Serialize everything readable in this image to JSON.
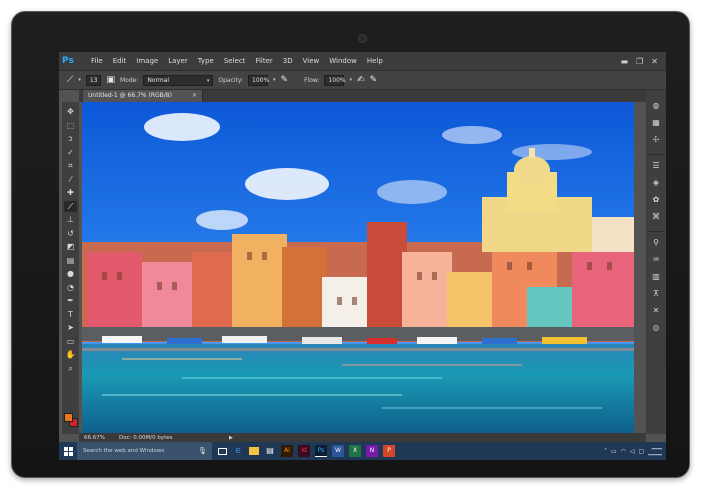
{
  "app": {
    "logo": "Ps",
    "menu": [
      "File",
      "Edit",
      "Image",
      "Layer",
      "Type",
      "Select",
      "Filter",
      "3D",
      "View",
      "Window",
      "Help"
    ],
    "window_controls": [
      "minimize-icon",
      "restore-icon",
      "close-icon"
    ]
  },
  "options_bar": {
    "brush_size": "13",
    "mode_label": "Mode:",
    "mode_value": "Normal",
    "opacity_label": "Opacity:",
    "opacity_value": "100%",
    "flow_label": "Flow:",
    "flow_value": "100%"
  },
  "document": {
    "tab_title": "Untitled-1 @ 66.7% (RGB/8)",
    "tab_close": "×"
  },
  "status_bar": {
    "zoom": "66.67%",
    "doc_info": "Doc: 0.00M/0 bytes"
  },
  "taskbar": {
    "search_placeholder": "Search the web and Windows",
    "apps": [
      {
        "icon": "task-view-icon",
        "color": "#ffffff"
      },
      {
        "icon": "edge-icon",
        "color": "#3d8ee8"
      },
      {
        "icon": "file-explorer-icon",
        "color": "#f3c43f"
      },
      {
        "icon": "store-icon",
        "color": "#ffffff"
      },
      {
        "icon": "illustrator-icon",
        "color": "#ff9a00",
        "label": "Ai"
      },
      {
        "icon": "indesign-icon",
        "color": "#ff3366",
        "label": "Id"
      },
      {
        "icon": "photoshop-icon",
        "color": "#31a8ff",
        "label": "Ps"
      },
      {
        "icon": "word-icon",
        "color": "#2b579a",
        "label": "W"
      },
      {
        "icon": "excel-icon",
        "color": "#217346",
        "label": "X"
      },
      {
        "icon": "onenote-icon",
        "color": "#7719aa",
        "label": "N"
      },
      {
        "icon": "powerpoint-icon",
        "color": "#d24726",
        "label": "P"
      }
    ]
  },
  "colors": {
    "foreground": "#e5781d",
    "background": "#d3242c",
    "accent_ps": "#31a8ff"
  }
}
